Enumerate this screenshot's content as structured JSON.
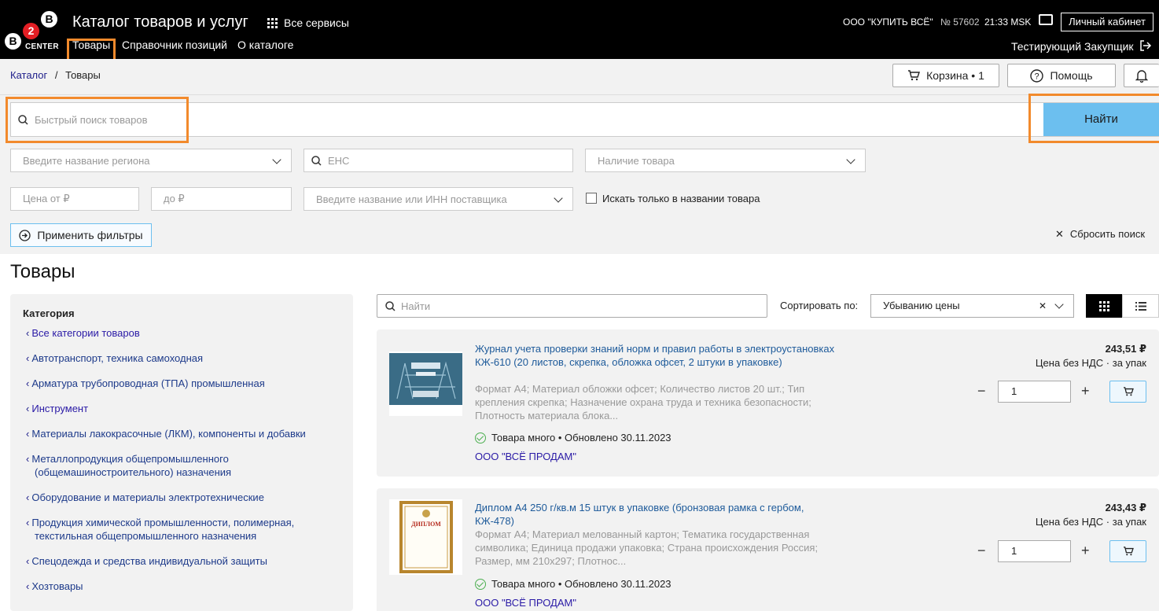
{
  "header": {
    "logo_b": "B",
    "logo_2": "2",
    "logo_center": "CENTER",
    "title": "Каталог товаров и услуг",
    "services": "Все сервисы",
    "nav": [
      "Товары",
      "Справочник позиций",
      "О каталоге"
    ],
    "org": "ООО \"КУПИТЬ ВСЁ\"",
    "org_number": "№ 57602",
    "time": "21:33 MSK",
    "cabinet": "Личный кабинет",
    "user": "Тестирующий Закупщик"
  },
  "breadcrumb": {
    "root": "Каталог",
    "separator": "/",
    "current": "Товары"
  },
  "actions": {
    "cart": "Корзина • 1",
    "help": "Помощь"
  },
  "search": {
    "placeholder": "Быстрый поиск товаров",
    "find_button": "Найти"
  },
  "filters": {
    "region_placeholder": "Введите название региона",
    "ens_placeholder": "ЕНС",
    "availability_placeholder": "Наличие товара",
    "price_from_placeholder": "Цена от ₽",
    "price_to_placeholder": "до ₽",
    "supplier_placeholder": "Введите название или ИНН поставщика",
    "name_only_label": "Искать только в названии товара",
    "apply_button": "Применить фильтры",
    "reset_button": "Сбросить поиск"
  },
  "main": {
    "heading": "Товары",
    "category_title": "Категория",
    "categories": [
      "Все категории товаров",
      "Автотранспорт, техника самоходная",
      "Арматура трубопроводная (ТПА) промышленная",
      "Инструмент",
      "Материалы лакокрасочные (ЛКМ), компоненты и добавки",
      "Металлопродукция общепромышленного (общемашиностроительного) назначения",
      "Оборудование и материалы электротехнические",
      "Продукция химической промышленности, полимерная, текстильная общепромышленного назначения",
      "Спецодежда и средства индивидуальной защиты",
      "Хозтовары"
    ],
    "list_search_placeholder": "Найти",
    "sort_label": "Сортировать по:",
    "sort_value": "Убыванию цены"
  },
  "products": [
    {
      "title": "Журнал учета проверки знаний норм и правил работы в электроустановках КЖ-610 (20 листов, скрепка, обложка офсет, 2 штуки в упаковке)",
      "description": "Формат А4; Материал обложки офсет; Количество листов 20 шт.; Тип крепления скрепка; Назначение охрана труда и техника безопасности; Плотность материала блока...",
      "stock": "Товара много • Обновлено 30.11.2023",
      "seller": "ООО \"ВСЁ ПРОДАМ\"",
      "price": "243,51 ₽",
      "unit": "Цена без НДС · за упак",
      "qty": "1"
    },
    {
      "title": "Диплом А4 250 г/кв.м 15 штук в упаковке (бронзовая рамка с гербом, КЖ-478)",
      "description": "Формат А4; Материал мелованный картон; Тематика государственная символика; Единица продажи упаковка; Страна происхождения Россия; Размер, мм 210х297; Плотнос...",
      "stock": "Товара много • Обновлено 30.11.2023",
      "seller": "ООО \"ВСЁ ПРОДАМ\"",
      "price": "243,43 ₽",
      "unit": "Цена без НДС · за упак",
      "qty": "1",
      "image_text": "ДИПЛОМ"
    }
  ],
  "colors": {
    "accent": "#6cbfef",
    "highlight": "#f28a2c",
    "header_bg": "#000000",
    "link": "#1d5a9a"
  }
}
